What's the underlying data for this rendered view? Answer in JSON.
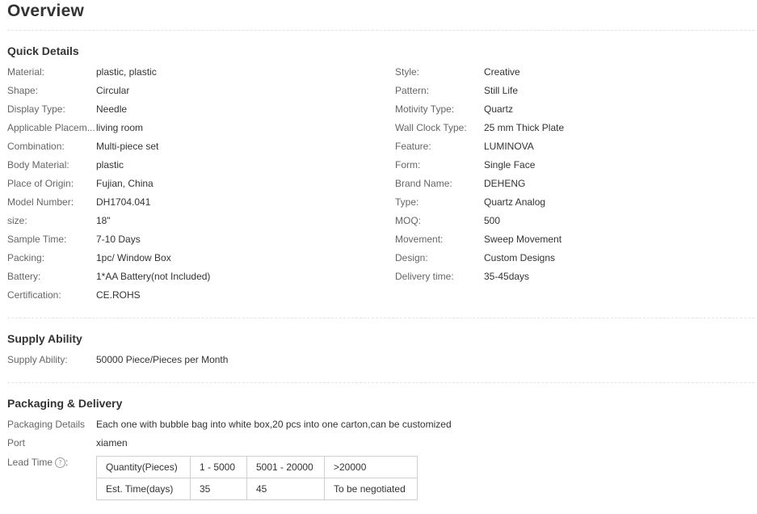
{
  "title": "Overview",
  "quick_details": {
    "heading": "Quick Details",
    "left": [
      {
        "label": "Material:",
        "value": "plastic, plastic"
      },
      {
        "label": "Shape:",
        "value": "Circular"
      },
      {
        "label": "Display Type:",
        "value": "Needle"
      },
      {
        "label": "Applicable Placem...",
        "value": "living room"
      },
      {
        "label": "Combination:",
        "value": "Multi-piece set"
      },
      {
        "label": "Body Material:",
        "value": "plastic"
      },
      {
        "label": "Place of Origin:",
        "value": "Fujian, China"
      },
      {
        "label": "Model Number:",
        "value": "DH1704.041"
      },
      {
        "label": "size:",
        "value": "18\""
      },
      {
        "label": "Sample Time:",
        "value": "7-10 Days"
      },
      {
        "label": "Packing:",
        "value": "1pc/ Window Box"
      },
      {
        "label": "Battery:",
        "value": "1*AA Battery(not Included)"
      },
      {
        "label": "Certification:",
        "value": "CE.ROHS"
      }
    ],
    "right": [
      {
        "label": "Style:",
        "value": "Creative"
      },
      {
        "label": "Pattern:",
        "value": "Still Life"
      },
      {
        "label": "Motivity Type:",
        "value": "Quartz"
      },
      {
        "label": "Wall Clock Type:",
        "value": "25 mm Thick Plate"
      },
      {
        "label": "Feature:",
        "value": "LUMINOVA"
      },
      {
        "label": "Form:",
        "value": "Single Face"
      },
      {
        "label": "Brand Name:",
        "value": "DEHENG"
      },
      {
        "label": "Type:",
        "value": "Quartz Analog"
      },
      {
        "label": "MOQ:",
        "value": "500"
      },
      {
        "label": "Movement:",
        "value": "Sweep Movement"
      },
      {
        "label": "Design:",
        "value": "Custom Designs"
      },
      {
        "label": "Delivery time:",
        "value": "35-45days"
      }
    ]
  },
  "supply_ability": {
    "heading": "Supply Ability",
    "label": "Supply Ability:",
    "value": "50000 Piece/Pieces per Month"
  },
  "packaging_delivery": {
    "heading": "Packaging & Delivery",
    "details_label": "Packaging Details",
    "details_value": "Each one with bubble bag into white box,20 pcs into one carton,can be customized",
    "port_label": "Port",
    "port_value": "xiamen",
    "lead_time_label": "Lead Time",
    "help_icon_glyph": "?",
    "lead_time_table": [
      [
        "Quantity(Pieces)",
        "1 - 5000",
        "5001 - 20000",
        ">20000"
      ],
      [
        "Est. Time(days)",
        "35",
        "45",
        "To be negotiated"
      ]
    ]
  }
}
